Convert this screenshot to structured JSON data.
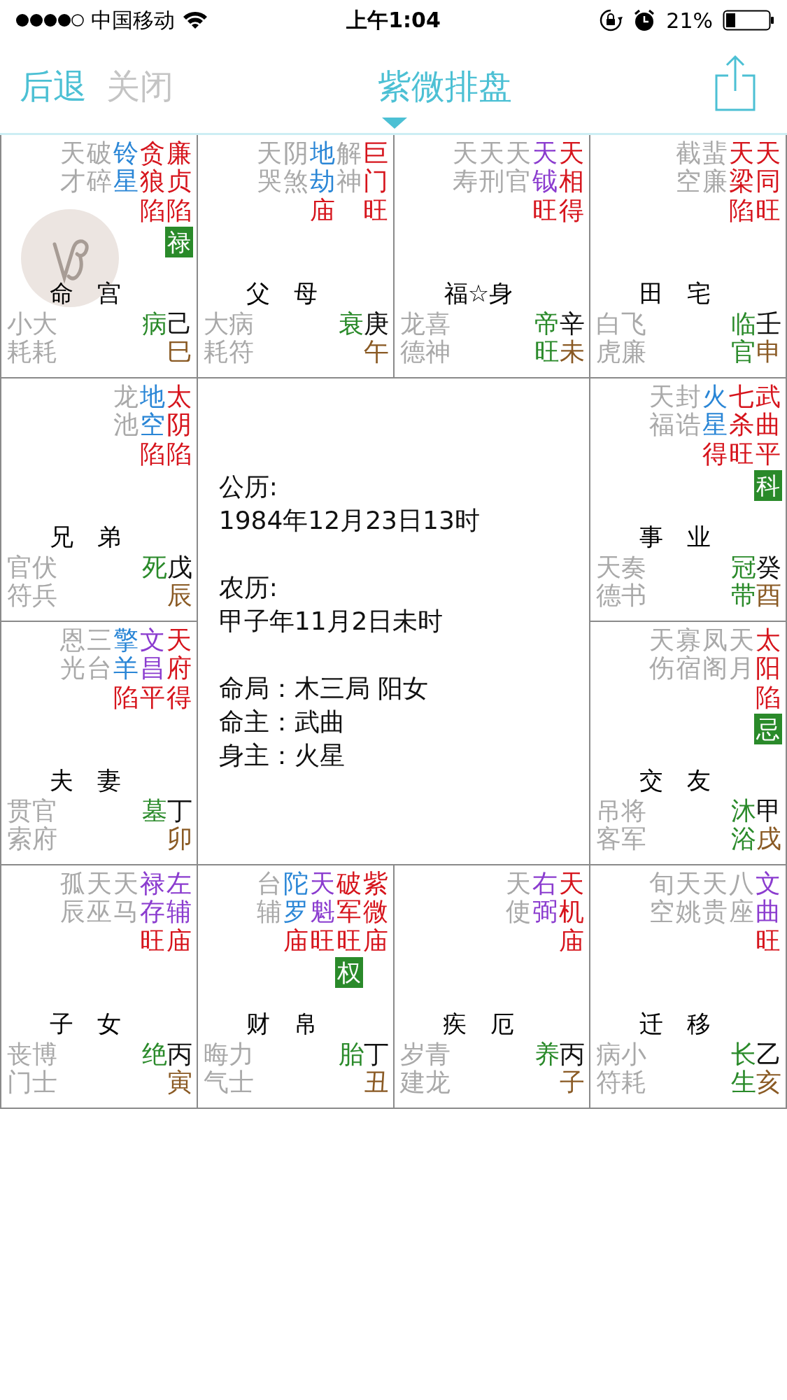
{
  "status_bar": {
    "carrier": "中国移动",
    "time": "上午1:04",
    "battery": "21%"
  },
  "nav": {
    "back": "后退",
    "close": {
      "label": "关闭",
      "disabled": true
    },
    "title": "紫微排盘"
  },
  "palaces": [
    {
      "name": "命　宫",
      "zodiac_badge": true,
      "stars": [
        {
          "name": "天才",
          "kind": "minor"
        },
        {
          "name": "破碎",
          "kind": "minor"
        },
        {
          "name": "铃星",
          "kind": "malefic"
        },
        {
          "name": "贪狼",
          "kind": "major",
          "brightness": "陷"
        },
        {
          "name": "廉贞",
          "kind": "major",
          "brightness": "陷",
          "transform": "禄"
        }
      ],
      "gods": [
        "小耗",
        "大耗"
      ],
      "stage": "病",
      "stem": "己",
      "branch": "巳"
    },
    {
      "name": "父　母",
      "stars": [
        {
          "name": "天哭",
          "kind": "minor"
        },
        {
          "name": "阴煞",
          "kind": "minor"
        },
        {
          "name": "地劫",
          "kind": "malefic",
          "brightness": "庙"
        },
        {
          "name": "解神",
          "kind": "minor"
        },
        {
          "name": "巨门",
          "kind": "major",
          "brightness": "旺"
        }
      ],
      "gods": [
        "大耗",
        "病符"
      ],
      "stage": "衰",
      "stem": "庚",
      "branch": "午"
    },
    {
      "name": "福☆身",
      "stars": [
        {
          "name": "天寿",
          "kind": "minor"
        },
        {
          "name": "天刑",
          "kind": "minor"
        },
        {
          "name": "天官",
          "kind": "minor"
        },
        {
          "name": "天钺",
          "kind": "lucky",
          "brightness": "旺"
        },
        {
          "name": "天相",
          "kind": "major",
          "brightness": "得"
        }
      ],
      "gods": [
        "龙德",
        "喜神"
      ],
      "stage": "帝旺",
      "stem": "辛",
      "branch": "未"
    },
    {
      "name": "田　宅",
      "stars": [
        {
          "name": "截空",
          "kind": "minor"
        },
        {
          "name": "蜚廉",
          "kind": "minor"
        },
        {
          "name": "天梁",
          "kind": "major",
          "brightness": "陷"
        },
        {
          "name": "天同",
          "kind": "major",
          "brightness": "旺"
        }
      ],
      "gods": [
        "白虎",
        "飞廉"
      ],
      "stage": "临官",
      "stem": "壬",
      "branch": "申"
    },
    {
      "name": "兄　弟",
      "stars": [
        {
          "name": "龙池",
          "kind": "minor"
        },
        {
          "name": "地空",
          "kind": "malefic",
          "brightness": "陷"
        },
        {
          "name": "太阴",
          "kind": "major",
          "brightness": "陷"
        }
      ],
      "gods": [
        "官符",
        "伏兵"
      ],
      "stage": "死",
      "stem": "戊",
      "branch": "辰"
    },
    {
      "name": "事　业",
      "stars": [
        {
          "name": "天福",
          "kind": "minor"
        },
        {
          "name": "封诰",
          "kind": "minor"
        },
        {
          "name": "火星",
          "kind": "malefic",
          "brightness": "得"
        },
        {
          "name": "七杀",
          "kind": "major",
          "brightness": "旺"
        },
        {
          "name": "武曲",
          "kind": "major",
          "brightness": "平",
          "transform": "科"
        }
      ],
      "gods": [
        "天德",
        "奏书"
      ],
      "stage": "冠带",
      "stem": "癸",
      "branch": "酉"
    },
    {
      "name": "夫　妻",
      "stars": [
        {
          "name": "恩光",
          "kind": "minor"
        },
        {
          "name": "三台",
          "kind": "minor"
        },
        {
          "name": "擎羊",
          "kind": "malefic",
          "brightness": "陷"
        },
        {
          "name": "文昌",
          "kind": "lucky",
          "brightness": "平"
        },
        {
          "name": "天府",
          "kind": "major",
          "brightness": "得"
        }
      ],
      "gods": [
        "贯索",
        "官府"
      ],
      "stage": "墓",
      "stem": "丁",
      "branch": "卯"
    },
    {
      "name": "交　友",
      "stars": [
        {
          "name": "天伤",
          "kind": "minor"
        },
        {
          "name": "寡宿",
          "kind": "minor"
        },
        {
          "name": "凤阁",
          "kind": "minor"
        },
        {
          "name": "天月",
          "kind": "minor"
        },
        {
          "name": "太阳",
          "kind": "major",
          "brightness": "陷",
          "transform": "忌"
        }
      ],
      "gods": [
        "吊客",
        "将军"
      ],
      "stage": "沐浴",
      "stem": "甲",
      "branch": "戌"
    },
    {
      "name": "子　女",
      "stars": [
        {
          "name": "孤辰",
          "kind": "minor"
        },
        {
          "name": "天巫",
          "kind": "minor"
        },
        {
          "name": "天马",
          "kind": "minor"
        },
        {
          "name": "禄存",
          "kind": "lucky",
          "brightness": "旺"
        },
        {
          "name": "左辅",
          "kind": "lucky",
          "brightness": "庙"
        }
      ],
      "gods": [
        "丧门",
        "博士"
      ],
      "stage": "绝",
      "stem": "丙",
      "branch": "寅"
    },
    {
      "name": "财　帛",
      "stars": [
        {
          "name": "台辅",
          "kind": "minor"
        },
        {
          "name": "陀罗",
          "kind": "malefic",
          "brightness": "庙"
        },
        {
          "name": "天魁",
          "kind": "lucky",
          "brightness": "旺"
        },
        {
          "name": "破军",
          "kind": "major",
          "brightness": "旺",
          "transform": "权"
        },
        {
          "name": "紫微",
          "kind": "major",
          "brightness": "庙"
        }
      ],
      "gods": [
        "晦气",
        "力士"
      ],
      "stage": "胎",
      "stem": "丁",
      "branch": "丑"
    },
    {
      "name": "疾　厄",
      "stars": [
        {
          "name": "天使",
          "kind": "minor"
        },
        {
          "name": "右弼",
          "kind": "lucky"
        },
        {
          "name": "天机",
          "kind": "major",
          "brightness": "庙"
        }
      ],
      "gods": [
        "岁建",
        "青龙"
      ],
      "stage": "养",
      "stem": "丙",
      "branch": "子"
    },
    {
      "name": "迁　移",
      "stars": [
        {
          "name": "旬空",
          "kind": "minor"
        },
        {
          "name": "天姚",
          "kind": "minor"
        },
        {
          "name": "天贵",
          "kind": "minor"
        },
        {
          "name": "八座",
          "kind": "minor"
        },
        {
          "name": "文曲",
          "kind": "lucky",
          "brightness": "旺"
        }
      ],
      "gods": [
        "病符",
        "小耗"
      ],
      "stage": "长生",
      "stem": "乙",
      "branch": "亥"
    }
  ],
  "info_blocks": [
    [
      "公历:",
      "1984年12月23日13时"
    ],
    [
      "农历:",
      "甲子年11月2日未时"
    ],
    [
      "命局：木三局 阳女",
      "命主：武曲",
      "身主：火星"
    ]
  ]
}
